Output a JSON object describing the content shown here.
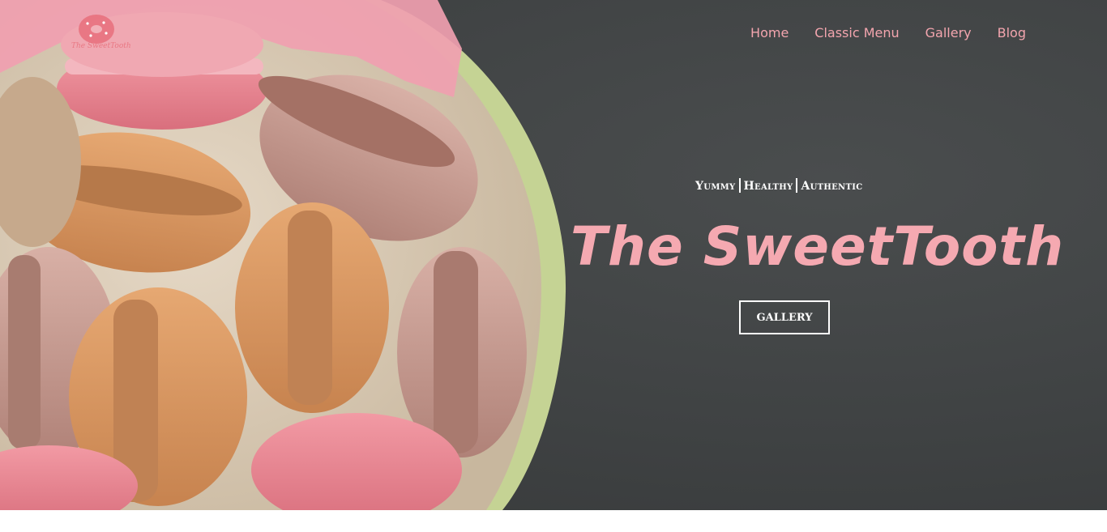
{
  "brand": {
    "logo_text": "The SweetTooth",
    "logo_icon": "donut-logo-icon"
  },
  "nav": {
    "items": [
      "Home",
      "Classic Menu",
      "Gallery",
      "Blog"
    ]
  },
  "hero": {
    "tagline": [
      "Yummy",
      "Healthy",
      "Authentic"
    ],
    "title": "The SweetTooth",
    "button_label": "GALLERY"
  },
  "colors": {
    "accent_pink": "#f5a9b1",
    "nav_pink": "#f3a5ae",
    "background_dark": "#404344",
    "bowl_green": "#b9c98a"
  }
}
